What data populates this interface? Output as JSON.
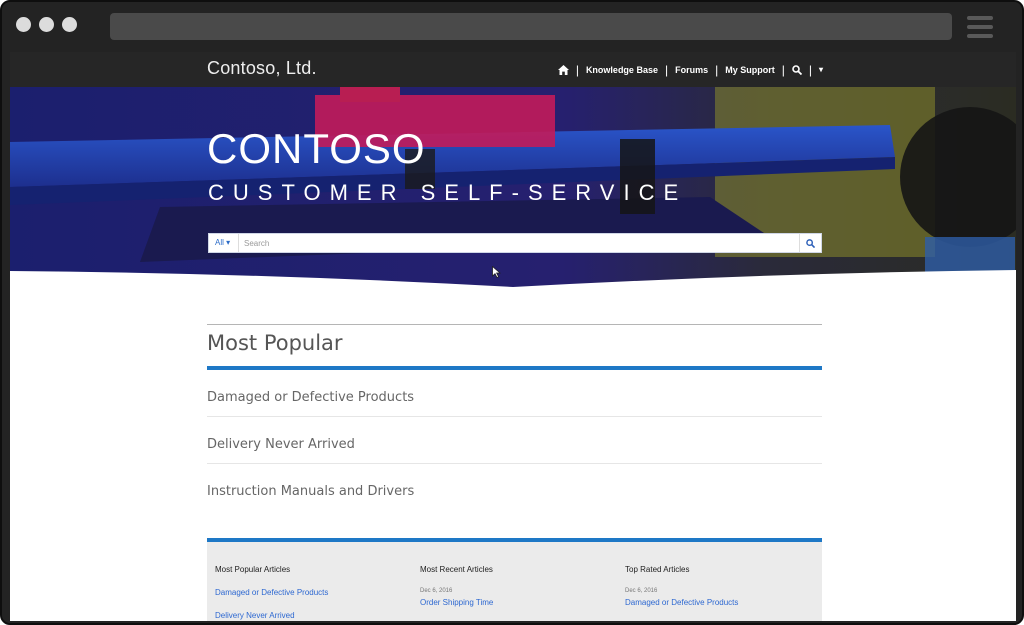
{
  "site": {
    "brand": "Contoso, Ltd."
  },
  "nav": {
    "items": [
      "Knowledge Base",
      "Forums",
      "My Support"
    ],
    "separator": "|",
    "dropdown_caret": "▾"
  },
  "hero": {
    "title": "CONTOSO",
    "subtitle": "CUSTOMER SELF-SERVICE"
  },
  "search": {
    "filter_label": "All ▾",
    "placeholder": "Search"
  },
  "most_popular": {
    "heading": "Most Popular",
    "items": [
      "Damaged or Defective Products",
      "Delivery Never Arrived",
      "Instruction Manuals and Drivers"
    ]
  },
  "footer": {
    "columns": [
      {
        "heading": "Most Popular Articles",
        "entries": [
          {
            "date": "",
            "title": "Damaged or Defective Products"
          },
          {
            "date": "",
            "title": "Delivery Never Arrived"
          }
        ]
      },
      {
        "heading": "Most Recent Articles",
        "entries": [
          {
            "date": "Dec 6, 2016",
            "title": "Order Shipping Time"
          }
        ]
      },
      {
        "heading": "Top Rated Articles",
        "entries": [
          {
            "date": "Dec 6, 2016",
            "title": "Damaged or Defective Products"
          }
        ]
      }
    ]
  },
  "colors": {
    "accent_blue": "#1e78c6",
    "nav_bg": "#262626",
    "link_blue": "#2d68d1"
  },
  "icons": [
    "home-icon",
    "search-icon",
    "chevron-down-icon",
    "hamburger-menu-icon",
    "mouse-cursor-icon"
  ]
}
